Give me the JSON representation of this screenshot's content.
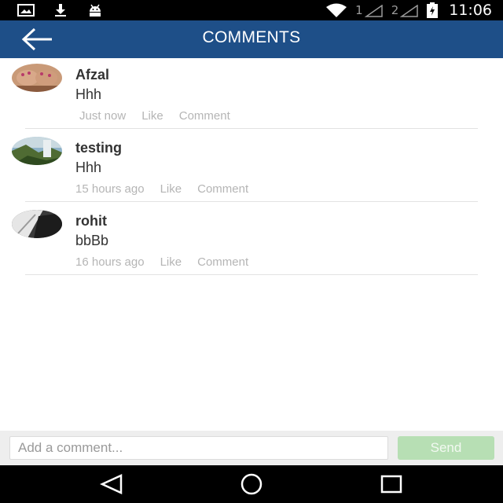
{
  "status_bar": {
    "time": "11:06",
    "sim1": "1",
    "sim2": "2",
    "icons": [
      "image-notification-icon",
      "download-icon",
      "android-icon",
      "wifi-icon",
      "signal-icon",
      "signal-icon",
      "battery-icon"
    ]
  },
  "app_bar": {
    "title": "COMMENTS",
    "back_icon": "arrow-left-icon",
    "color": "#1e4f88"
  },
  "comments": [
    {
      "author": "Afzal",
      "text": "Hhh",
      "time": "Just now",
      "like_label": "Like",
      "comment_label": "Comment"
    },
    {
      "author": "testing",
      "text": "Hhh",
      "time": "15 hours ago",
      "like_label": "Like",
      "comment_label": "Comment"
    },
    {
      "author": "rohit",
      "text": "bbBb",
      "time": "16 hours ago",
      "like_label": "Like",
      "comment_label": "Comment"
    }
  ],
  "composer": {
    "placeholder": "Add a comment...",
    "value": "",
    "send_label": "Send",
    "send_color": "#b7dfb4"
  },
  "nav_bar": {
    "icons": [
      "back-triangle-icon",
      "home-circle-icon",
      "recents-square-icon"
    ]
  }
}
